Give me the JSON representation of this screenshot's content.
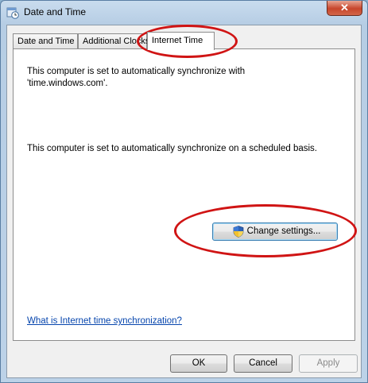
{
  "window": {
    "title": "Date and Time",
    "close_label": "✕"
  },
  "tabs": [
    {
      "label": "Date and Time"
    },
    {
      "label": "Additional Clocks"
    },
    {
      "label": "Internet Time",
      "active": true
    }
  ],
  "panel": {
    "line1": "This computer is set to automatically synchronize with",
    "line2": "'time.windows.com'.",
    "schedule": "This computer is set to automatically synchronize on a scheduled basis.",
    "change_settings": "Change settings...",
    "help_link": "What is Internet time synchronization?"
  },
  "buttons": {
    "ok": "OK",
    "cancel": "Cancel",
    "apply": "Apply"
  },
  "colors": {
    "annotation": "#d01414",
    "link": "#0645ad"
  }
}
